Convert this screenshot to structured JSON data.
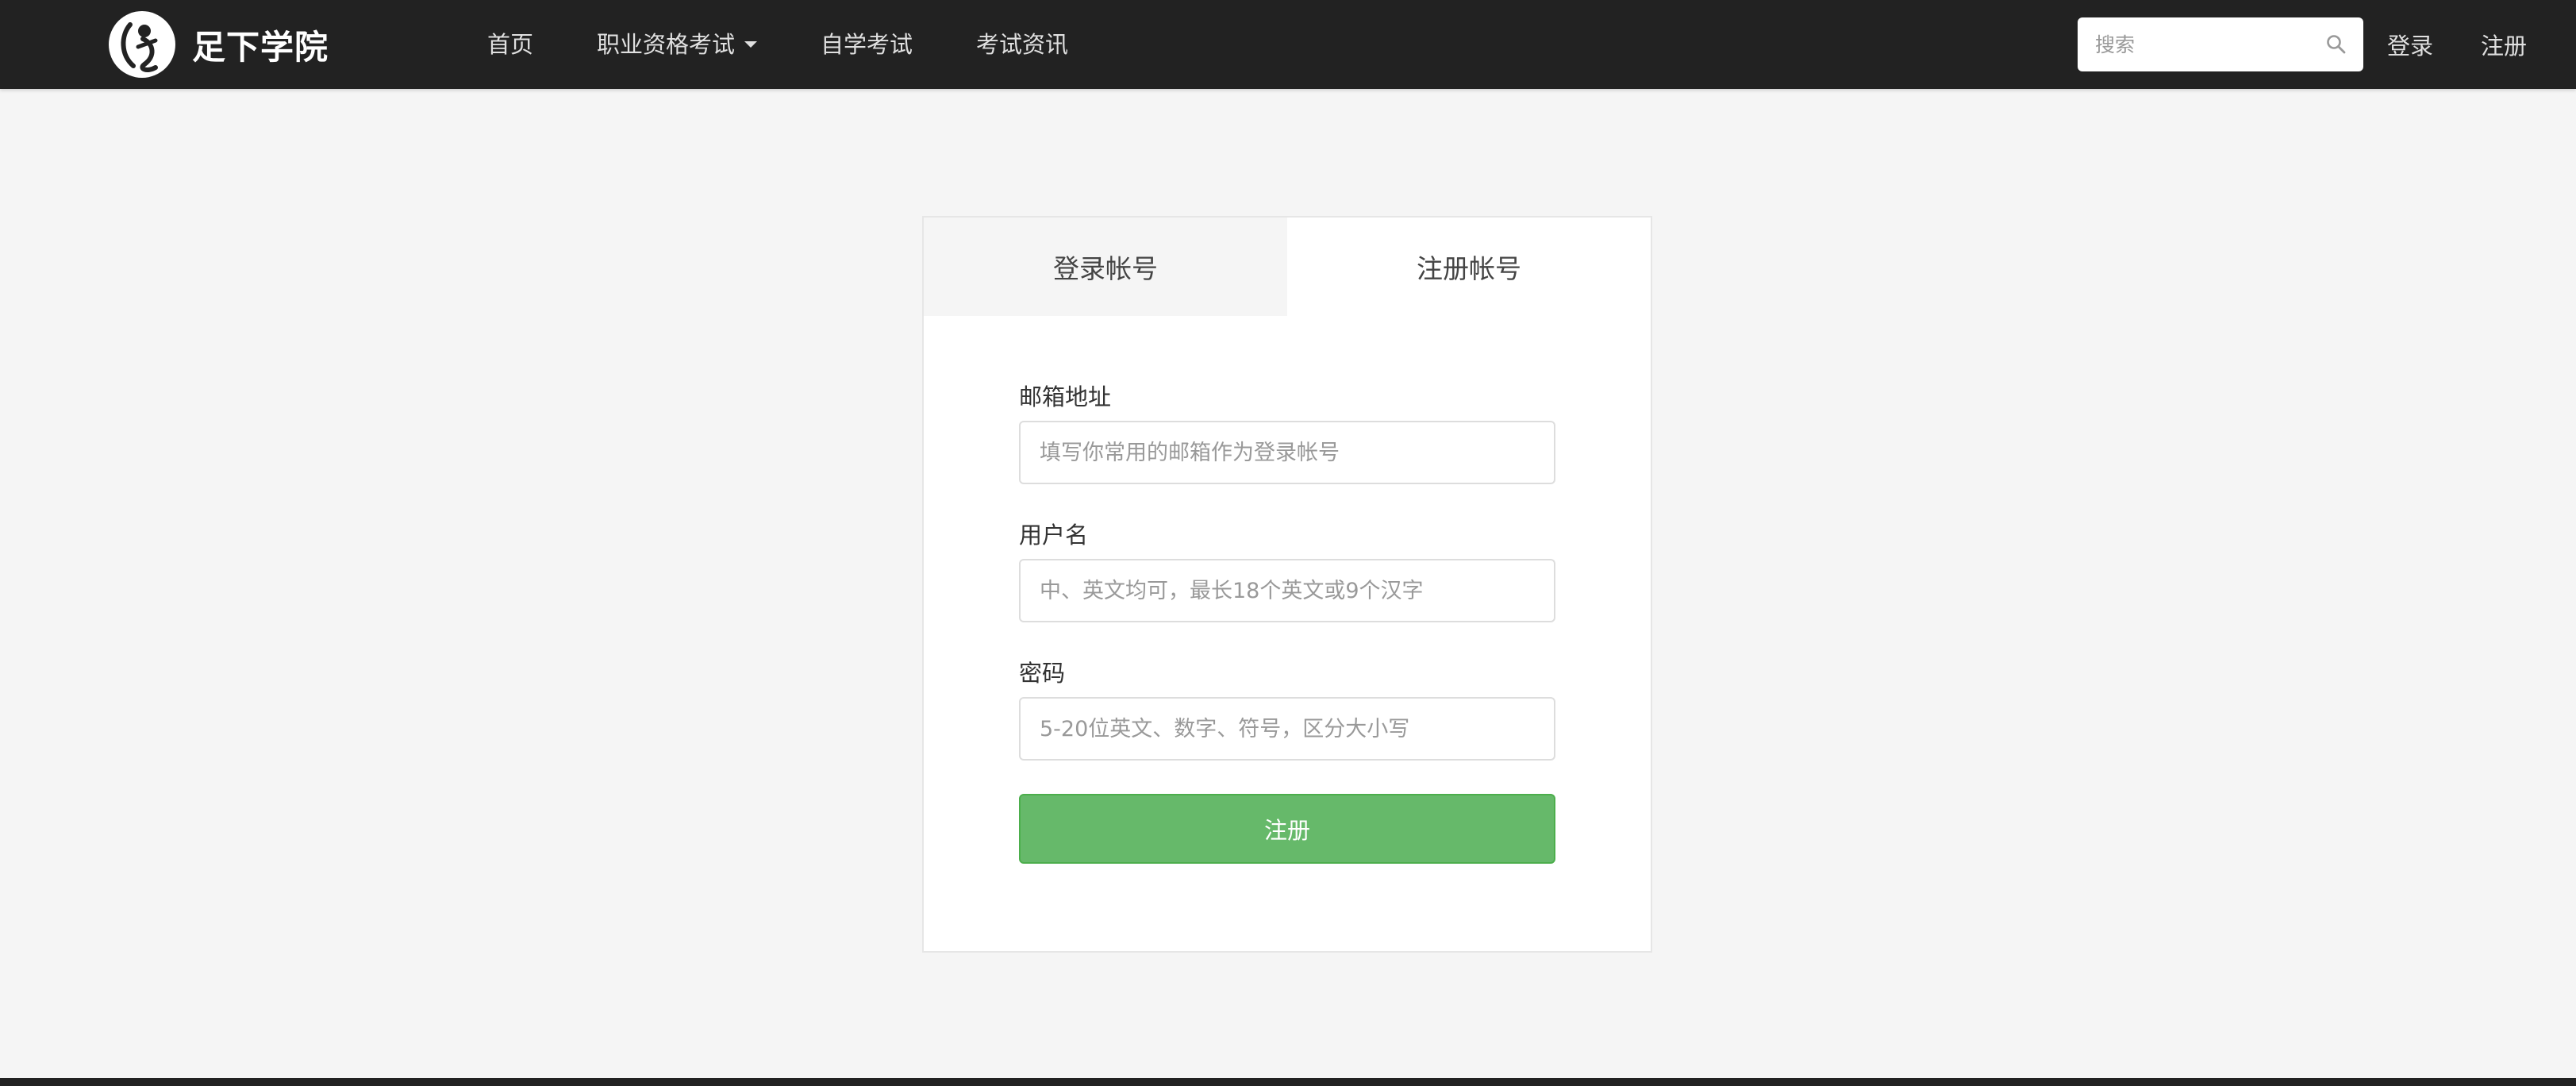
{
  "navbar": {
    "logo_text": "足下学院",
    "links": [
      {
        "label": "首页"
      },
      {
        "label": "职业资格考试",
        "has_dropdown": true
      },
      {
        "label": "自学考试"
      },
      {
        "label": "考试资讯"
      }
    ],
    "search": {
      "placeholder": "搜索",
      "icon": "search-icon"
    },
    "login_label": "登录",
    "register_label": "注册"
  },
  "card": {
    "tabs": [
      {
        "label": "登录帐号",
        "active": false
      },
      {
        "label": "注册帐号",
        "active": true
      }
    ],
    "form": {
      "email": {
        "label": "邮箱地址",
        "placeholder": "填写你常用的邮箱作为登录帐号",
        "value": ""
      },
      "username": {
        "label": "用户名",
        "placeholder": "中、英文均可，最长18个英文或9个汉字",
        "value": ""
      },
      "password": {
        "label": "密码",
        "placeholder": "5-20位英文、数字、符号，区分大小写",
        "value": ""
      },
      "submit_label": "注册"
    }
  },
  "colors": {
    "navbar_bg": "#222222",
    "page_bg": "#f5f5f5",
    "primary_button": "#66b96a"
  }
}
